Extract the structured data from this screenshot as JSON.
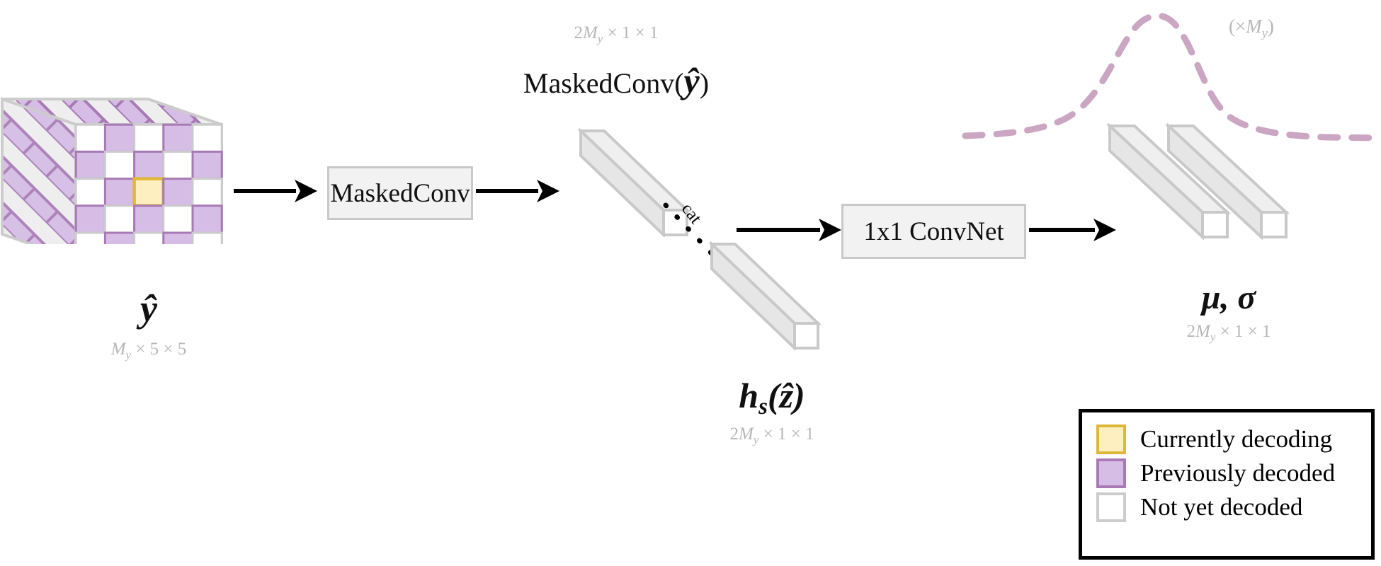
{
  "figure": {
    "title": "Masked convolution context model decoding diagram",
    "background": "#ffffff"
  },
  "colors": {
    "previously_decoded_fill": "#d6bde6",
    "previously_decoded_stroke": "#a87ab5",
    "currently_decoding_fill": "#fdefc0",
    "currently_decoding_stroke": "#dfb739",
    "not_yet_decoded_fill": "#ffffff",
    "not_yet_decoded_stroke": "#cccccc",
    "box_fill": "#f2f2f2",
    "box_stroke": "#c9c9c9",
    "arrow": "#000000",
    "dim_text": "#b7b7b7",
    "curve": "#cba6c3",
    "legend_border": "#000000"
  },
  "tensor_cube": {
    "name": "y-hat tensor",
    "label": "ŷ",
    "dims_text": "M_y × 5 × 5",
    "dims": {
      "prefix": "",
      "symbol": "M",
      "subscript": "y",
      "rest": "× 5 × 5"
    },
    "grid_rows": 5,
    "grid_cols": 5,
    "cell_states": [
      [
        "not",
        "prev",
        "not",
        "prev",
        "not"
      ],
      [
        "prev",
        "not",
        "prev",
        "not",
        "prev"
      ],
      [
        "not",
        "prev",
        "current",
        "prev",
        "not"
      ],
      [
        "prev",
        "not",
        "prev",
        "not",
        "prev"
      ],
      [
        "not",
        "prev",
        "not",
        "prev",
        "not"
      ]
    ],
    "stripes": "diagonal purple stripes on top and left faces"
  },
  "masked_conv_box": {
    "label": "MaskedConv"
  },
  "masked_conv_output": {
    "label_prefix": "MaskedConv(",
    "label_var": "ŷ",
    "label_suffix": ")",
    "dims_text": "2M_y × 1 × 1",
    "dims": {
      "prefix": "2",
      "symbol": "M",
      "subscript": "y",
      "rest": "× 1 × 1"
    }
  },
  "hyper_output": {
    "label_prefix": "h",
    "label_sub": "s",
    "label_suffix": "(ẑ)",
    "dims_text": "2M_y × 1 × 1",
    "dims": {
      "prefix": "2",
      "symbol": "M",
      "subscript": "y",
      "rest": "× 1 × 1"
    }
  },
  "concat": {
    "label": "cat"
  },
  "convnet_box": {
    "label": "1x1 ConvNet"
  },
  "final_output": {
    "label": "μ, σ",
    "dims_text": "2M_y × 1 × 1",
    "dims": {
      "prefix": "2",
      "symbol": "M",
      "subscript": "y",
      "rest": "× 1 × 1"
    }
  },
  "distribution_curve": {
    "name": "gaussian-curve",
    "annotation_text": "(×M_y)",
    "annotation": {
      "prefix": "(×",
      "symbol": "M",
      "subscript": "y",
      "rest": ")"
    },
    "style": "dashed",
    "color": "#cba6c3"
  },
  "legend": {
    "items": [
      {
        "label": "Currently decoding",
        "fill": "#fdefc0",
        "stroke": "#dfb739"
      },
      {
        "label": "Previously decoded",
        "fill": "#d6bde6",
        "stroke": "#a87ab5"
      },
      {
        "label": "Not yet decoded",
        "fill": "#ffffff",
        "stroke": "#cccccc"
      }
    ]
  },
  "arrows": [
    {
      "name": "arrow-cube-to-maskedconv"
    },
    {
      "name": "arrow-maskedconv-to-output"
    },
    {
      "name": "arrow-concat-to-convnet"
    },
    {
      "name": "arrow-convnet-to-musigma"
    }
  ]
}
